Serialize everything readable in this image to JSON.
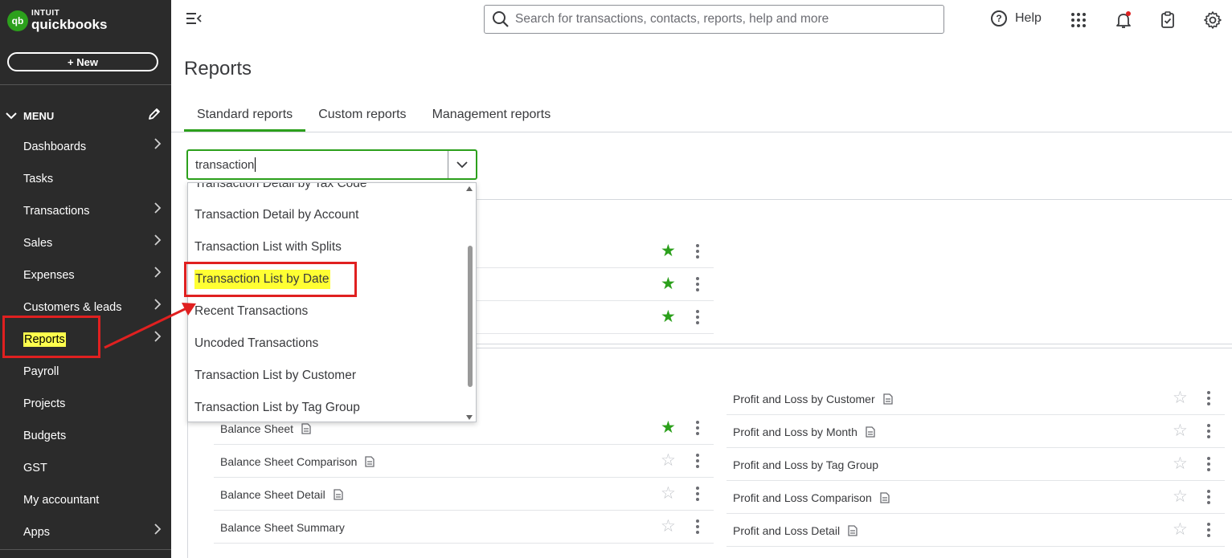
{
  "app": {
    "logo_top": "INTUIT",
    "logo_bottom": "quickbooks",
    "logo_mark": "qb",
    "new_button": "+ New"
  },
  "sidebar": {
    "menu_label": "MENU",
    "items": [
      {
        "label": "Dashboards",
        "has_arrow": true
      },
      {
        "label": "Tasks",
        "has_arrow": false
      },
      {
        "label": "Transactions",
        "has_arrow": true
      },
      {
        "label": "Sales",
        "has_arrow": true
      },
      {
        "label": "Expenses",
        "has_arrow": true
      },
      {
        "label": "Customers & leads",
        "has_arrow": true
      },
      {
        "label": "Reports",
        "has_arrow": true,
        "active": true
      },
      {
        "label": "Payroll",
        "has_arrow": false
      },
      {
        "label": "Projects",
        "has_arrow": false
      },
      {
        "label": "Budgets",
        "has_arrow": false
      },
      {
        "label": "GST",
        "has_arrow": false
      },
      {
        "label": "My accountant",
        "has_arrow": false
      },
      {
        "label": "Apps",
        "has_arrow": true
      }
    ]
  },
  "topbar": {
    "search_placeholder": "Search for transactions, contacts, reports, help and more",
    "help_label": "Help",
    "icons": [
      "menu-collapse-icon",
      "search-icon",
      "help-icon",
      "apps-grid-icon",
      "bell-icon",
      "clipboard-icon",
      "gear-icon"
    ]
  },
  "page": {
    "title": "Reports",
    "tabs": [
      "Standard reports",
      "Custom reports",
      "Management reports"
    ],
    "active_tab": "Standard reports"
  },
  "search_combo": {
    "value": "transaction"
  },
  "dropdown": {
    "partial_item": "Transaction Detail by Tax Code",
    "items": [
      "Transaction Detail by Account",
      "Transaction List with Splits",
      "Transaction List by Date",
      "Recent Transactions",
      "Uncoded Transactions",
      "Transaction List by Customer",
      "Transaction List by Tag Group"
    ],
    "highlighted": "Transaction List by Date"
  },
  "favourites_rows": [
    {
      "favourite": true
    },
    {
      "favourite": true
    },
    {
      "favourite": true
    }
  ],
  "reports_left": [
    {
      "name": "Balance Sheet",
      "favourite": true,
      "doc_icon": true
    },
    {
      "name": "Balance Sheet Comparison",
      "favourite": false,
      "doc_icon": true
    },
    {
      "name": "Balance Sheet Detail",
      "favourite": false,
      "doc_icon": true
    },
    {
      "name": "Balance Sheet Summary",
      "favourite": false,
      "doc_icon": false
    }
  ],
  "reports_right": [
    {
      "name": "Profit and Loss by Customer",
      "favourite": false,
      "doc_icon": true
    },
    {
      "name": "Profit and Loss by Month",
      "favourite": false,
      "doc_icon": true
    },
    {
      "name": "Profit and Loss by Tag Group",
      "favourite": false,
      "doc_icon": false
    },
    {
      "name": "Profit and Loss Comparison",
      "favourite": false,
      "doc_icon": true
    },
    {
      "name": "Profit and Loss Detail",
      "favourite": false,
      "doc_icon": true
    }
  ],
  "colors": {
    "brand_green": "#2ca01c",
    "sidebar_bg": "#2b2b2b",
    "highlight_yellow": "#ffff33",
    "annotation_red": "#e02020"
  }
}
